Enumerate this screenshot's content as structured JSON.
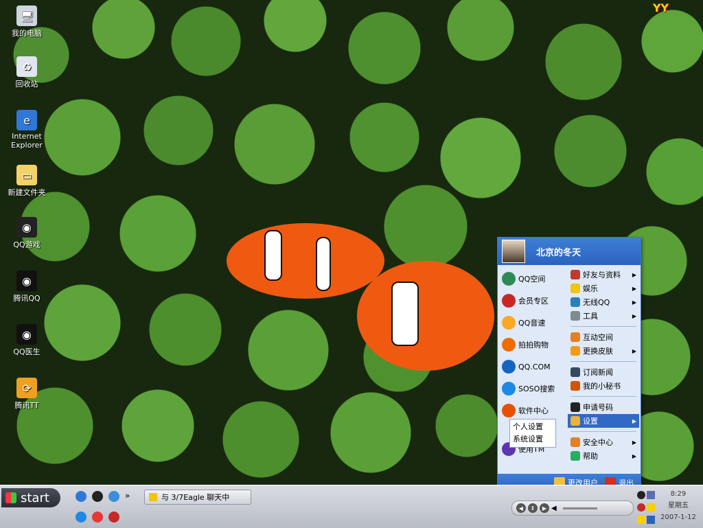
{
  "desktop": {
    "icons": [
      {
        "label": "我的电脑",
        "icon": "computer-icon"
      },
      {
        "label": "回收站",
        "icon": "recycle-bin-icon"
      },
      {
        "label": "Internet Explorer",
        "icon": "ie-icon"
      },
      {
        "label": "新建文件夹",
        "icon": "folder-icon"
      },
      {
        "label": "QQ游戏",
        "icon": "qq-game-icon"
      },
      {
        "label": "腾讯QQ",
        "icon": "qq-icon"
      },
      {
        "label": "QQ医生",
        "icon": "qq-doctor-icon"
      },
      {
        "label": "腾讯TT",
        "icon": "tt-browser-icon"
      }
    ]
  },
  "qq_menu": {
    "username": "北京的冬天",
    "left_items": [
      {
        "label": "QQ空间",
        "icon": "qzone-icon",
        "color": "#2e8b57"
      },
      {
        "label": "会员专区",
        "icon": "vip-icon",
        "color": "#c62828"
      },
      {
        "label": "QQ音速",
        "icon": "music-icon",
        "color": "#f9a825"
      },
      {
        "label": "拍拍购物",
        "icon": "shop-icon",
        "color": "#ef6c00"
      },
      {
        "label": "QQ.COM",
        "icon": "qqcom-icon",
        "color": "#1565c0"
      },
      {
        "label": "SOSO搜索",
        "icon": "search-icon",
        "color": "#1e88e5"
      },
      {
        "label": "软件中心",
        "icon": "software-icon",
        "color": "#e65100"
      },
      {
        "label": "使用TM",
        "icon": "tm-icon",
        "color": "#5e35b1"
      }
    ],
    "right_groups": [
      [
        {
          "label": "好友与资料",
          "arrow": true
        },
        {
          "label": "娱乐",
          "arrow": true
        },
        {
          "label": "无线QQ",
          "arrow": true
        },
        {
          "label": "工具",
          "arrow": true
        }
      ],
      [
        {
          "label": "互动空间",
          "arrow": false
        },
        {
          "label": "更换皮肤",
          "arrow": true
        }
      ],
      [
        {
          "label": "订阅新闻",
          "arrow": false
        },
        {
          "label": "我的小秘书",
          "arrow": false
        }
      ],
      [
        {
          "label": "申请号码",
          "arrow": false
        },
        {
          "label": "设置",
          "arrow": true,
          "selected": true
        }
      ],
      [
        {
          "label": "安全中心",
          "arrow": true
        },
        {
          "label": "帮助",
          "arrow": true
        }
      ]
    ],
    "submenu": [
      "个人设置",
      "系统设置"
    ],
    "footer": {
      "change_user": "更改用户",
      "exit": "退出"
    }
  },
  "taskbar": {
    "start_label": "start",
    "task_button": "与 3/7Eagle 聊天中",
    "quick_launch_more": "»",
    "clock": {
      "time": "8:29",
      "day": "星期五",
      "date": "2007-1-12"
    }
  },
  "colors": {
    "accent": "#2a63be",
    "menu_bg": "#dfe9f7",
    "selected": "#316ac5"
  }
}
